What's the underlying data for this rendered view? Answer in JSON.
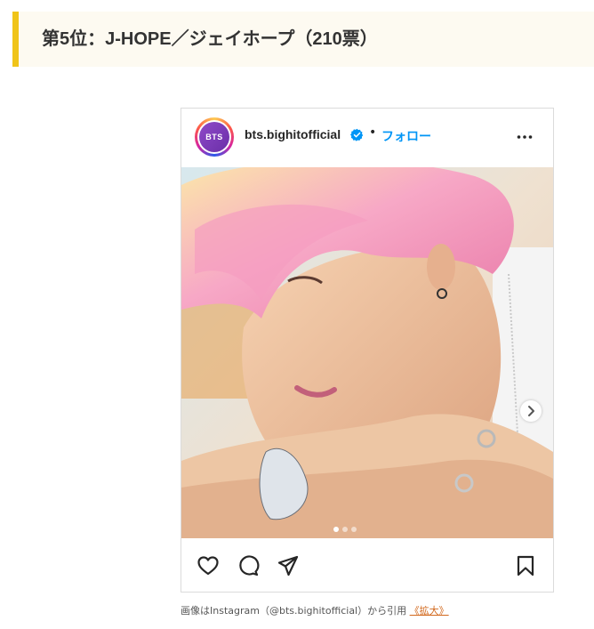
{
  "heading": {
    "text": "第5位：J-HOPE／ジェイホープ（210票）"
  },
  "post": {
    "avatar_text": "BTS",
    "username": "bts.bighitofficial",
    "separator": "•",
    "follow_label": "フォロー",
    "more_icon": "more-horizontal-icon",
    "carousel": {
      "total": 3,
      "active_index": 0
    }
  },
  "actions": {
    "like_icon": "heart-icon",
    "comment_icon": "comment-icon",
    "share_icon": "send-icon",
    "save_icon": "bookmark-icon"
  },
  "caption": {
    "text": "画像はInstagram（@bts.bighitofficial）から引用",
    "link_label": "《拡大》"
  },
  "colors": {
    "accent_bar": "#f0c419",
    "heading_bg": "#fdfaf1",
    "follow": "#0095f6",
    "link": "#d2691e"
  }
}
